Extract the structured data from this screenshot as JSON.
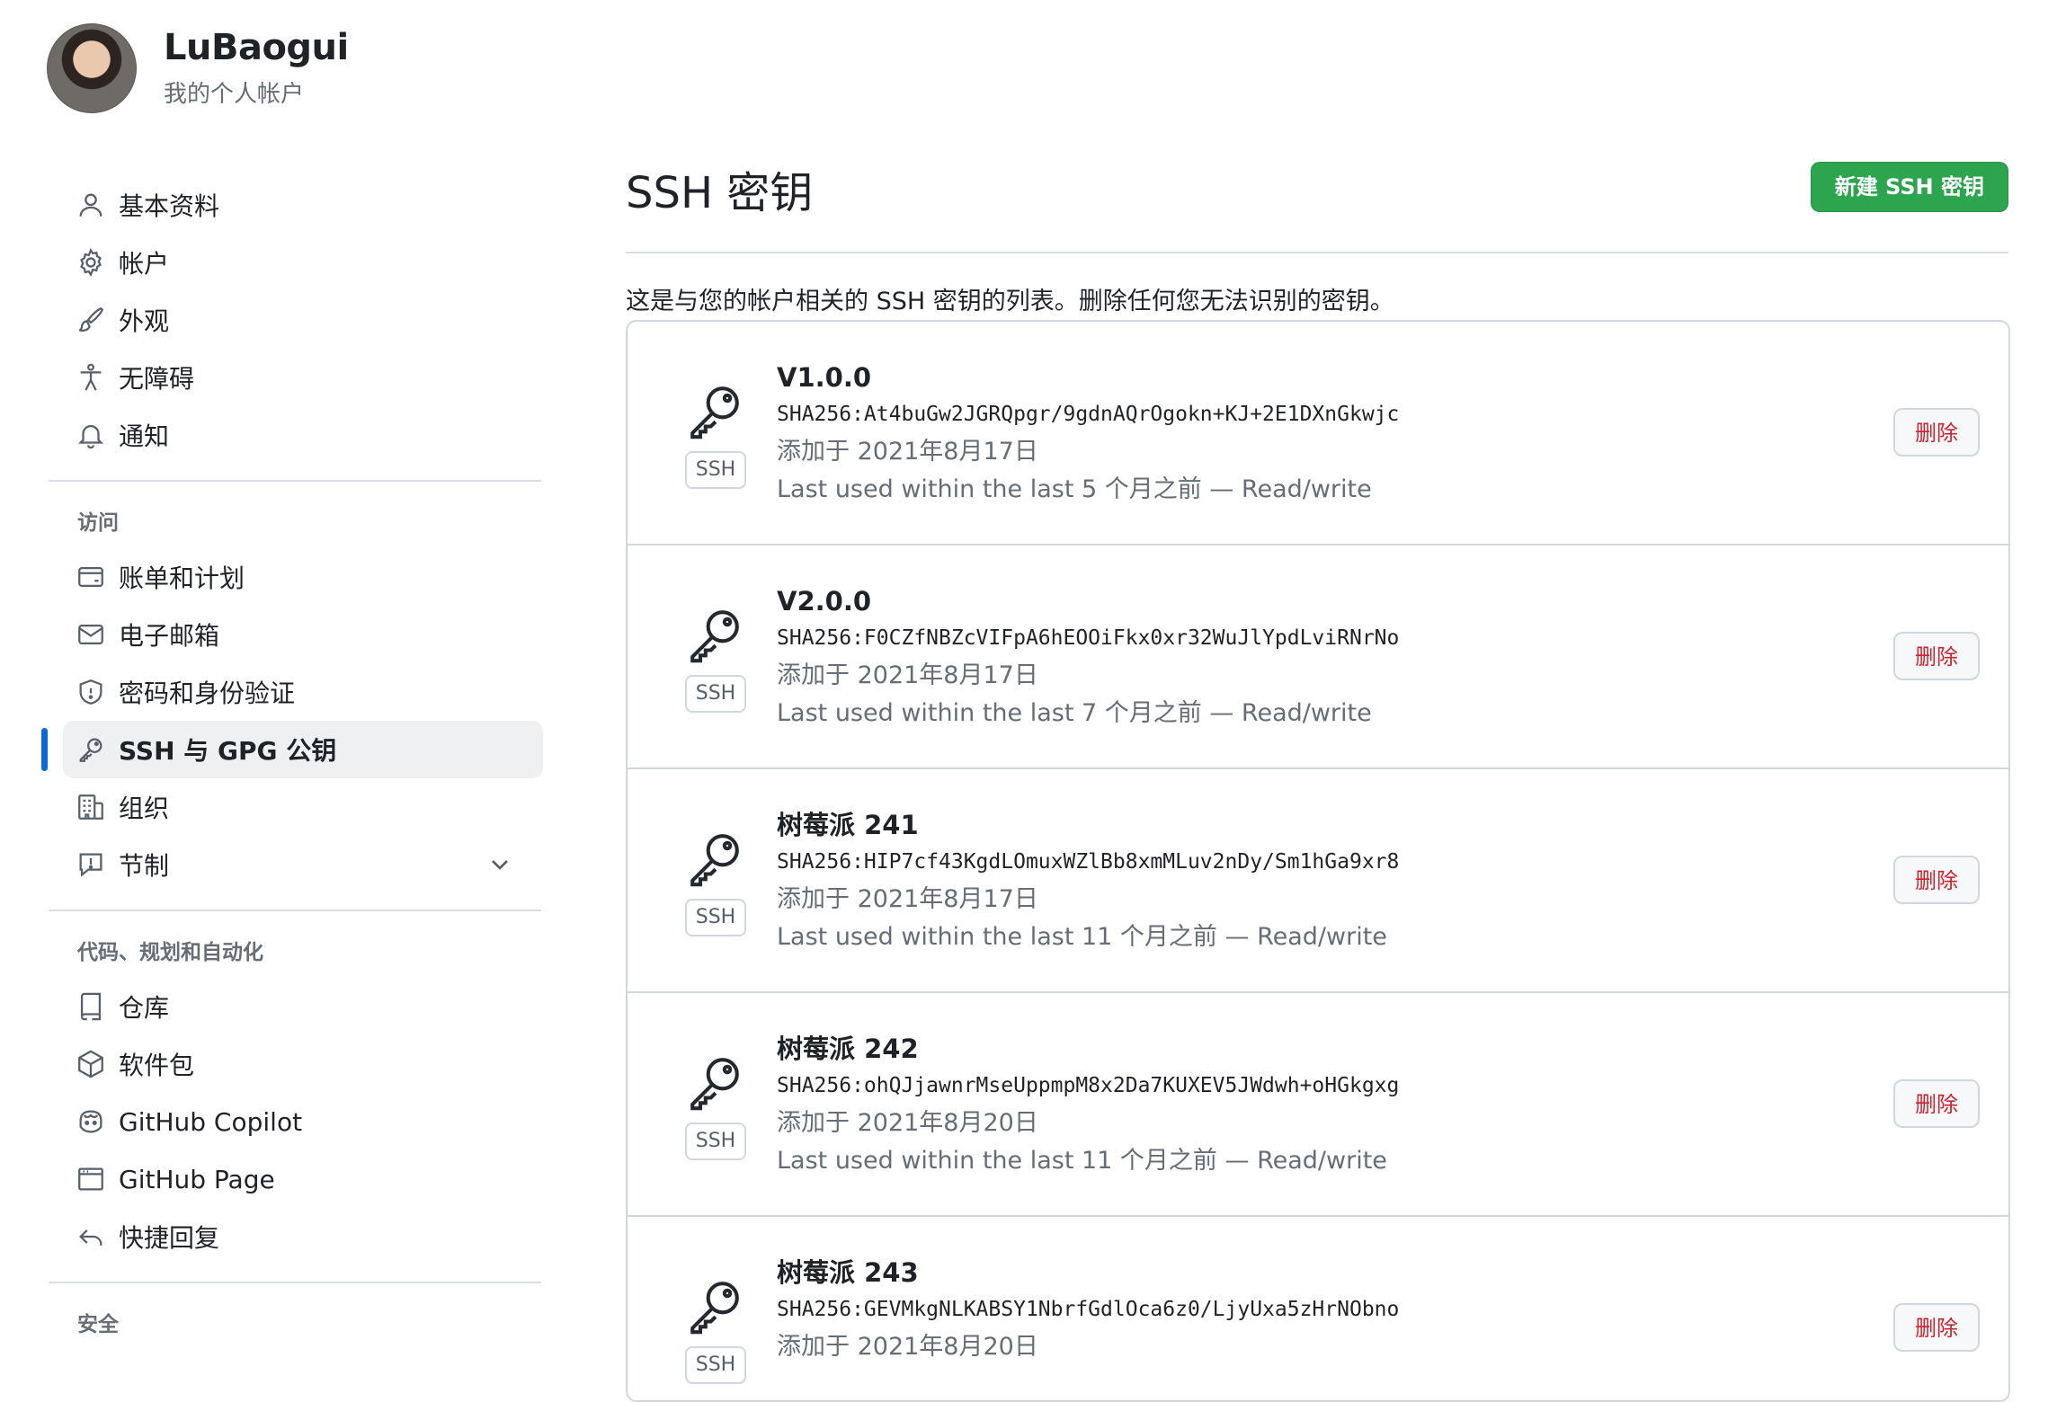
{
  "header": {
    "username": "LuBaogui",
    "subtitle": "我的个人帐户"
  },
  "sidebar": {
    "group1": [
      {
        "label": "基本资料",
        "icon": "person-icon"
      },
      {
        "label": "帐户",
        "icon": "gear-icon"
      },
      {
        "label": "外观",
        "icon": "paintbrush-icon"
      },
      {
        "label": "无障碍",
        "icon": "accessibility-icon"
      },
      {
        "label": "通知",
        "icon": "bell-icon"
      }
    ],
    "section_access": "访问",
    "group2": [
      {
        "label": "账单和计划",
        "icon": "credit-card-icon"
      },
      {
        "label": "电子邮箱",
        "icon": "mail-icon"
      },
      {
        "label": "密码和身份验证",
        "icon": "shield-icon"
      },
      {
        "label": "SSH 与 GPG 公钥",
        "icon": "key-icon",
        "active": true
      },
      {
        "label": "组织",
        "icon": "organization-icon"
      },
      {
        "label": "节制",
        "icon": "report-icon"
      }
    ],
    "section_code": "代码、规划和自动化",
    "group3": [
      {
        "label": "仓库",
        "icon": "repo-icon"
      },
      {
        "label": "软件包",
        "icon": "package-icon"
      },
      {
        "label": "GitHub Copilot",
        "icon": "copilot-icon"
      },
      {
        "label": "GitHub Page",
        "icon": "browser-icon"
      },
      {
        "label": "快捷回复",
        "icon": "reply-icon"
      }
    ],
    "section_security": "安全"
  },
  "main": {
    "title": "SSH 密钥",
    "new_button": "新建 SSH 密钥",
    "description": "这是与您的帐户相关的 SSH 密钥的列表。删除任何您无法识别的密钥。",
    "badge": "SSH",
    "delete_label": "删除",
    "keys": [
      {
        "title": "V1.0.0",
        "fingerprint": "SHA256:At4buGw2JGRQpgr/9gdnAQrOgokn+KJ+2E1DXnGkwjc",
        "added": "添加于 2021年8月17日",
        "last_used": "Last used within the last 5 个月之前 — Read/write"
      },
      {
        "title": "V2.0.0",
        "fingerprint": "SHA256:F0CZfNBZcVIFpA6hEOOiFkx0xr32WuJlYpdLviRNrNo",
        "added": "添加于 2021年8月17日",
        "last_used": "Last used within the last 7 个月之前 — Read/write"
      },
      {
        "title": "树莓派 241",
        "fingerprint": "SHA256:HIP7cf43KgdLOmuxWZlBb8xmMLuv2nDy/Sm1hGa9xr8",
        "added": "添加于 2021年8月17日",
        "last_used": "Last used within the last 11 个月之前 — Read/write"
      },
      {
        "title": "树莓派 242",
        "fingerprint": "SHA256:ohQJjawnrMseUppmpM8x2Da7KUXEV5JWdwh+oHGkgxg",
        "added": "添加于 2021年8月20日",
        "last_used": "Last used within the last 11 个月之前 — Read/write"
      },
      {
        "title": "树莓派 243",
        "fingerprint": "SHA256:GEVMkgNLKABSY1NbrfGdlOca6z0/LjyUxa5zHrNObno",
        "added": "添加于 2021年8月20日",
        "last_used": ""
      }
    ]
  },
  "colors": {
    "accent": "#0969da",
    "primary_button": "#2da44e",
    "danger": "#cf222e",
    "muted_text": "#656d76",
    "border": "#d0d7de"
  }
}
